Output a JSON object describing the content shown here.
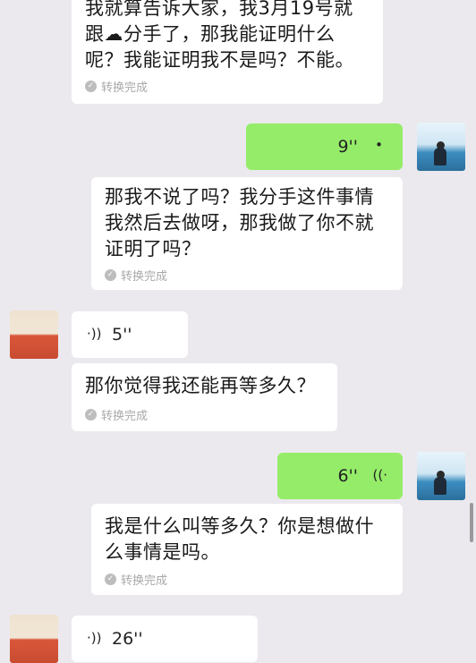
{
  "messages": [
    {
      "type": "transcript",
      "lines": [
        "我就算告诉大家，我3月19号就",
        "跟☁分手了，那我能证明什么",
        "呢？我能证明我不是吗？不能。"
      ],
      "status": "转换完成"
    },
    {
      "type": "voice",
      "side": "right",
      "duration": "9''"
    },
    {
      "type": "transcript",
      "lines": [
        "那我不说了吗？我分手这件事情",
        "我然后去做呀，那我做了你不就",
        "证明了吗？"
      ],
      "status": "转换完成"
    },
    {
      "type": "voice",
      "side": "left",
      "duration": "5''"
    },
    {
      "type": "transcript",
      "lines": [
        "那你觉得我还能再等多久？"
      ],
      "status": "转换完成"
    },
    {
      "type": "voice",
      "side": "right",
      "duration": "6''"
    },
    {
      "type": "transcript",
      "lines": [
        "我是什么叫等多久？你是想做什",
        "么事情是吗。"
      ],
      "status": "转换完成"
    },
    {
      "type": "voice",
      "side": "left",
      "duration": "26''"
    }
  ],
  "icons": {
    "check": "check-circle-icon",
    "voice_wave": "voice-wave-icon"
  },
  "colors": {
    "background": "#ebe9ee",
    "green_bubble": "#95ec69",
    "white_bubble": "#ffffff"
  }
}
